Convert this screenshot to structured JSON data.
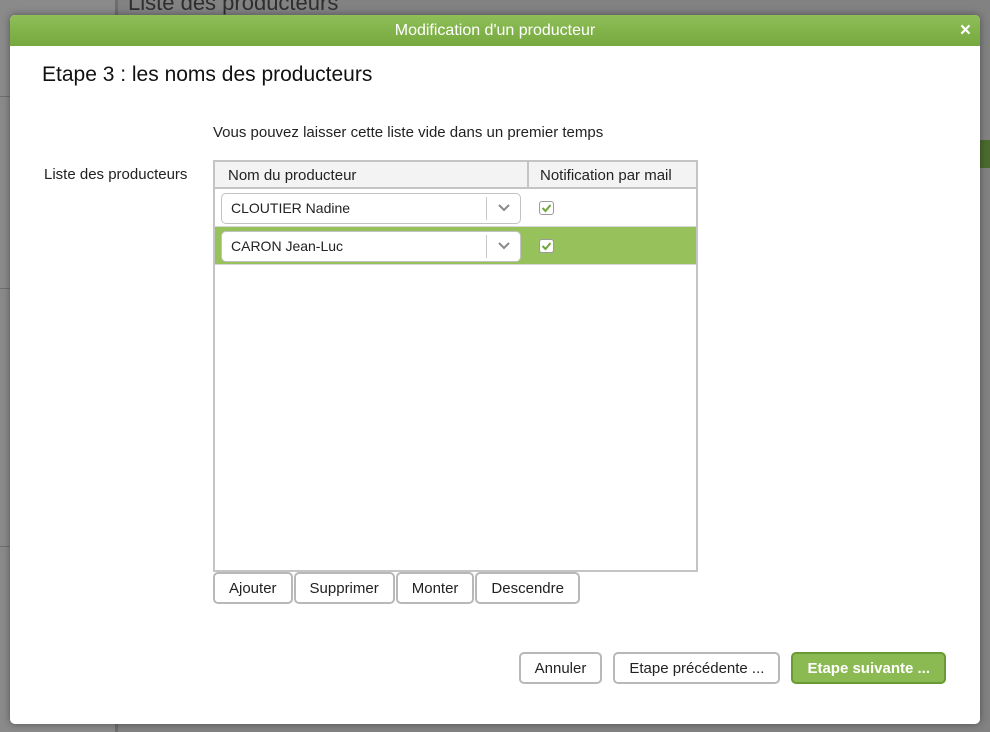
{
  "background": {
    "title": "Liste des producteurs"
  },
  "dialog": {
    "title": "Modification d'un producteur",
    "close_label": "×",
    "step_heading": "Etape 3 : les noms des producteurs",
    "hint": "Vous pouvez laisser cette liste vide dans un premier temps",
    "list_label": "Liste des producteurs",
    "grid": {
      "columns": [
        "Nom du producteur",
        "Notification par mail"
      ],
      "rows": [
        {
          "name": "CLOUTIER Nadine",
          "notify": true,
          "selected": false
        },
        {
          "name": "CARON Jean-Luc",
          "notify": true,
          "selected": true
        }
      ]
    },
    "list_buttons": {
      "add": "Ajouter",
      "remove": "Supprimer",
      "up": "Monter",
      "down": "Descendre"
    },
    "footer": {
      "cancel": "Annuler",
      "previous": "Etape précédente ...",
      "next": "Etape suivante ..."
    }
  },
  "colors": {
    "accent": "#8cba52",
    "selected_row": "#97c15b"
  }
}
